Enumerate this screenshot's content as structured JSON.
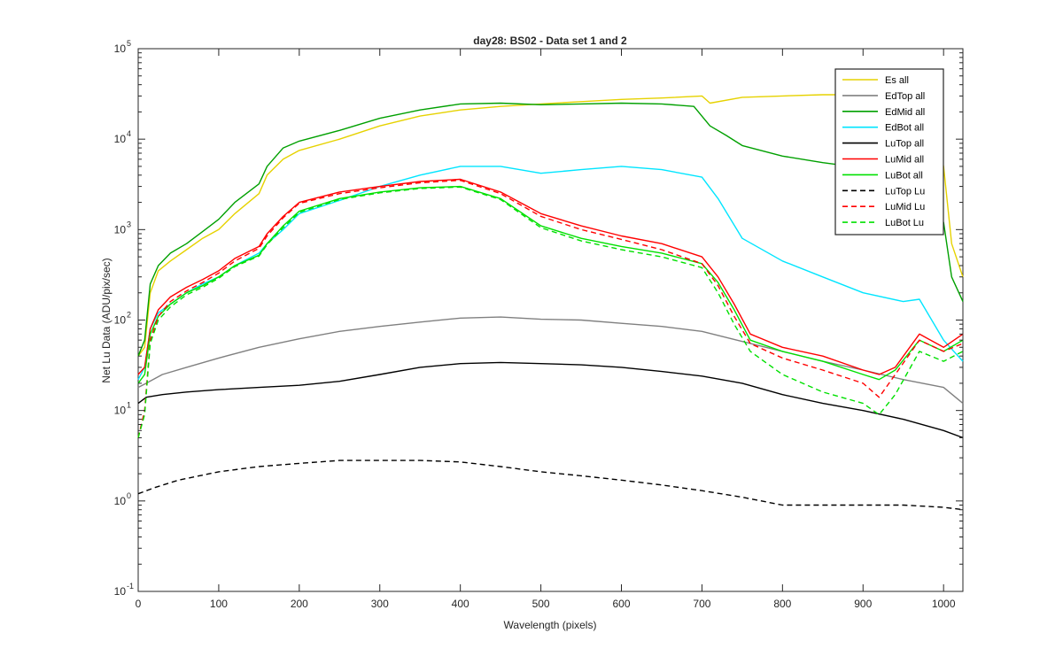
{
  "chart_data": {
    "type": "line",
    "title": "day28: BS02 - Data set 1 and 2",
    "xlabel": "Wavelength (pixels)",
    "ylabel": "Net Lu Data (ADU/pix/sec)",
    "xlim": [
      0,
      1024
    ],
    "ylim": [
      0.1,
      100000
    ],
    "yscale": "log",
    "grid": false,
    "legend_position": "top-right",
    "x_ticks": [
      0,
      100,
      200,
      300,
      400,
      500,
      600,
      700,
      800,
      900,
      1000
    ],
    "x_tick_labels": [
      "0",
      "100",
      "200",
      "300",
      "400",
      "500",
      "600",
      "700",
      "800",
      "900",
      "1000"
    ],
    "y_ticks": [
      0.1,
      1,
      10,
      100,
      1000,
      10000,
      100000
    ],
    "y_tick_bases": [
      "10",
      "10",
      "10",
      "10",
      "10",
      "10",
      "10"
    ],
    "y_tick_exps": [
      "-1",
      "0",
      "1",
      "2",
      "3",
      "4",
      "5"
    ],
    "series": [
      {
        "name": "Es  all",
        "color": "#e6d200",
        "dash": "solid",
        "x": [
          0,
          8,
          15,
          25,
          40,
          60,
          80,
          100,
          120,
          150,
          160,
          180,
          200,
          250,
          300,
          350,
          400,
          450,
          500,
          550,
          600,
          650,
          700,
          710,
          750,
          800,
          850,
          900,
          950,
          980,
          1000,
          1010,
          1024
        ],
        "y": [
          40,
          50,
          200,
          350,
          450,
          600,
          800,
          1000,
          1500,
          2500,
          4000,
          6000,
          7500,
          10000,
          14000,
          18000,
          21000,
          23000,
          24500,
          26000,
          27500,
          28500,
          30000,
          25000,
          29000,
          30000,
          31000,
          31000,
          30000,
          28000,
          5000,
          700,
          300
        ]
      },
      {
        "name": "EdTop  all",
        "color": "#808080",
        "dash": "solid",
        "x": [
          0,
          10,
          30,
          60,
          100,
          150,
          200,
          250,
          300,
          350,
          400,
          450,
          500,
          550,
          600,
          650,
          700,
          750,
          800,
          850,
          900,
          950,
          1000,
          1024
        ],
        "y": [
          18,
          20,
          25,
          30,
          38,
          50,
          62,
          75,
          85,
          95,
          105,
          108,
          102,
          100,
          92,
          85,
          75,
          58,
          45,
          35,
          28,
          22,
          18,
          12
        ]
      },
      {
        "name": "EdMid  all",
        "color": "#00a000",
        "dash": "solid",
        "x": [
          0,
          8,
          15,
          25,
          40,
          60,
          80,
          100,
          120,
          150,
          160,
          180,
          200,
          250,
          300,
          350,
          400,
          450,
          500,
          550,
          600,
          650,
          690,
          710,
          730,
          750,
          800,
          850,
          900,
          950,
          1000,
          1010,
          1024
        ],
        "y": [
          40,
          60,
          250,
          400,
          550,
          700,
          950,
          1300,
          2000,
          3200,
          5000,
          8000,
          9500,
          12500,
          17000,
          21000,
          24500,
          25000,
          24000,
          24500,
          25000,
          24500,
          23000,
          14000,
          11000,
          8500,
          6500,
          5500,
          4800,
          4000,
          1200,
          300,
          160
        ]
      },
      {
        "name": "EdBot  all",
        "color": "#00e5ff",
        "dash": "solid",
        "x": [
          0,
          8,
          15,
          25,
          40,
          60,
          80,
          100,
          120,
          150,
          160,
          180,
          200,
          250,
          300,
          350,
          400,
          450,
          500,
          550,
          600,
          650,
          700,
          720,
          750,
          800,
          850,
          900,
          950,
          970,
          1000,
          1024
        ],
        "y": [
          22,
          30,
          80,
          120,
          150,
          200,
          250,
          300,
          400,
          550,
          700,
          1000,
          1500,
          2100,
          3000,
          4000,
          5000,
          5000,
          4200,
          4600,
          5000,
          4600,
          3800,
          2200,
          800,
          450,
          300,
          200,
          160,
          170,
          60,
          35
        ]
      },
      {
        "name": "LuTop  all",
        "color": "#000000",
        "dash": "solid",
        "x": [
          0,
          10,
          30,
          60,
          100,
          150,
          200,
          250,
          300,
          350,
          400,
          450,
          500,
          550,
          600,
          650,
          700,
          750,
          800,
          850,
          900,
          950,
          1000,
          1024
        ],
        "y": [
          12,
          14,
          15,
          16,
          17,
          18,
          19,
          21,
          25,
          30,
          33,
          34,
          33,
          32,
          30,
          27,
          24,
          20,
          15,
          12,
          10,
          8,
          6,
          5
        ]
      },
      {
        "name": "LuMid  all",
        "color": "#ff0000",
        "dash": "solid",
        "x": [
          0,
          8,
          15,
          25,
          40,
          60,
          80,
          100,
          120,
          150,
          160,
          180,
          200,
          250,
          300,
          350,
          400,
          450,
          500,
          550,
          600,
          650,
          700,
          720,
          740,
          760,
          800,
          850,
          900,
          920,
          940,
          970,
          1000,
          1024
        ],
        "y": [
          25,
          30,
          80,
          130,
          180,
          230,
          280,
          350,
          480,
          650,
          900,
          1400,
          2000,
          2600,
          3000,
          3400,
          3600,
          2600,
          1500,
          1100,
          850,
          700,
          500,
          300,
          150,
          70,
          50,
          40,
          28,
          25,
          30,
          70,
          50,
          70
        ]
      },
      {
        "name": "LuBot  all",
        "color": "#00e000",
        "dash": "solid",
        "x": [
          0,
          8,
          15,
          25,
          40,
          60,
          80,
          100,
          120,
          150,
          160,
          180,
          200,
          250,
          300,
          350,
          400,
          450,
          500,
          550,
          600,
          650,
          700,
          720,
          740,
          760,
          800,
          850,
          900,
          920,
          940,
          970,
          1000,
          1024
        ],
        "y": [
          20,
          25,
          70,
          110,
          150,
          200,
          240,
          300,
          400,
          520,
          700,
          1100,
          1600,
          2200,
          2600,
          2900,
          3000,
          2200,
          1100,
          800,
          650,
          550,
          420,
          260,
          130,
          60,
          45,
          35,
          25,
          22,
          28,
          60,
          45,
          60
        ]
      },
      {
        "name": "LuTop  Lu",
        "color": "#000000",
        "dash": "dashed",
        "x": [
          0,
          20,
          50,
          100,
          150,
          200,
          250,
          300,
          350,
          400,
          450,
          500,
          550,
          600,
          650,
          700,
          750,
          800,
          850,
          900,
          950,
          1000,
          1024
        ],
        "y": [
          1.2,
          1.4,
          1.7,
          2.1,
          2.4,
          2.6,
          2.8,
          2.8,
          2.8,
          2.7,
          2.4,
          2.1,
          1.9,
          1.7,
          1.5,
          1.3,
          1.1,
          0.9,
          0.9,
          0.9,
          0.9,
          0.85,
          0.8
        ]
      },
      {
        "name": "LuMid  Lu",
        "color": "#ff0000",
        "dash": "dashed",
        "x": [
          0,
          8,
          15,
          25,
          40,
          60,
          80,
          100,
          120,
          150,
          160,
          180,
          200,
          250,
          300,
          350,
          400,
          450,
          500,
          550,
          600,
          650,
          700,
          720,
          740,
          760,
          800,
          850,
          900,
          920,
          940,
          970,
          1000,
          1024
        ],
        "y": [
          5,
          10,
          60,
          110,
          160,
          210,
          260,
          330,
          450,
          620,
          850,
          1350,
          1950,
          2500,
          2900,
          3300,
          3500,
          2500,
          1400,
          1000,
          780,
          600,
          420,
          240,
          110,
          55,
          38,
          28,
          20,
          14,
          25,
          60,
          45,
          55
        ]
      },
      {
        "name": "LuBot  Lu",
        "color": "#00e000",
        "dash": "dashed",
        "x": [
          0,
          8,
          15,
          25,
          40,
          60,
          80,
          100,
          120,
          150,
          160,
          180,
          200,
          250,
          300,
          350,
          400,
          450,
          500,
          550,
          600,
          650,
          700,
          720,
          740,
          760,
          800,
          850,
          900,
          920,
          940,
          970,
          1000,
          1024
        ],
        "y": [
          5,
          9,
          55,
          100,
          140,
          190,
          230,
          290,
          390,
          510,
          680,
          1050,
          1550,
          2150,
          2550,
          2850,
          2950,
          2150,
          1050,
          750,
          600,
          500,
          380,
          200,
          90,
          45,
          25,
          16,
          12,
          9,
          15,
          45,
          35,
          45
        ]
      }
    ]
  }
}
